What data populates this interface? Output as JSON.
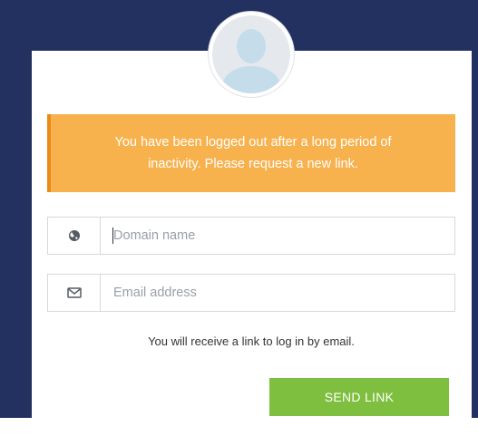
{
  "alert": {
    "line1": "You have been logged out after a long period of",
    "line2": "inactivity. Please request a new link."
  },
  "form": {
    "domain": {
      "icon": "globe-icon",
      "value": "",
      "placeholder": "Domain name"
    },
    "email": {
      "icon": "envelope-icon",
      "value": "",
      "placeholder": "Email address"
    },
    "hint": "You will receive a link to log in by email.",
    "send_label": "SEND LINK"
  },
  "avatar": {
    "icon": "user-silhouette-icon"
  },
  "colors": {
    "background": "#233161",
    "alert_fill": "#f7b24e",
    "alert_border": "#e88b17",
    "button": "#7fbf3f",
    "avatar_figure": "#c5dcea"
  }
}
